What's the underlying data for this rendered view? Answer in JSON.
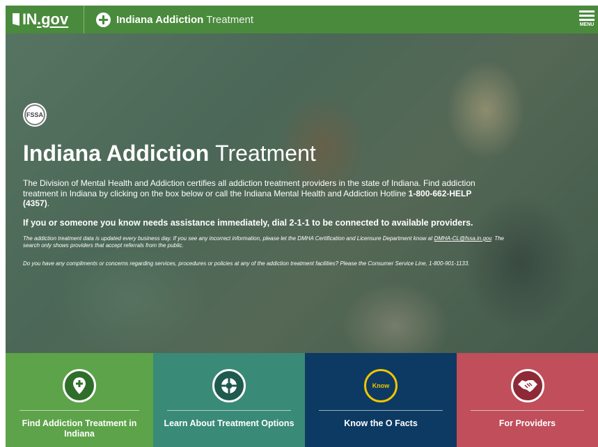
{
  "header": {
    "site_in": "IN",
    "site_gov": ".gov",
    "brand_strong": "Indiana Addiction",
    "brand_light": "Treatment",
    "menu_label": "MENU"
  },
  "hero": {
    "seal_text": "FSSA",
    "title_strong": "Indiana Addiction",
    "title_light": "Treatment",
    "p1_text": "The Division of Mental Health and Addiction certifies all addiction treatment providers in the state of Indiana. Find addiction treatment in Indiana by clicking on the box below or call the Indiana Mental Health and Addiction Hotline ",
    "p1_hotline": "1-800-662-HELP (4357)",
    "p1_end": ".",
    "p2": "If you or someone you know needs assistance immediately, dial 2-1-1 to be connected to available providers.",
    "p3_text": "The addiction treatment data is updated every business day. If you see any incorrect information, please let the DMHA Certification and Licensure Department know at ",
    "p3_email": "DMHA-CL@fssa.in.gov",
    "p3_end": ". The search only shows providers that accept referrals from the public.",
    "p4": "Do you have any compliments or concerns regarding services, procedures or policies at any of the addiction treatment facilities? Please the Consumer Service Line, 1-800-901-1133."
  },
  "tiles": [
    {
      "label": "Find Addiction Treatment in Indiana",
      "icon": "map-pin-plus-icon",
      "color": "#5da349"
    },
    {
      "label": "Learn About Treatment Options",
      "icon": "life-ring-icon",
      "color": "#3a8a78"
    },
    {
      "label": "Know the O Facts",
      "icon": "know-badge-icon",
      "icon_text": "Know",
      "color": "#0d3a63"
    },
    {
      "label": "For Providers",
      "icon": "handshake-icon",
      "color": "#c04e5b"
    }
  ],
  "colors": {
    "header_green": "#4a8a3c",
    "know_yellow": "#f2c400"
  }
}
